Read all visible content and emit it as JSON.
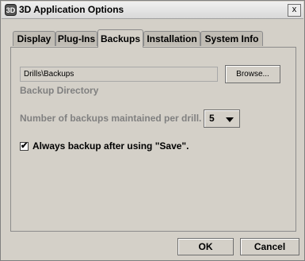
{
  "window": {
    "title": "3D Application Options",
    "close_label": "x"
  },
  "tabs": [
    {
      "label": "Display",
      "active": false
    },
    {
      "label": "Plug-Ins",
      "active": false
    },
    {
      "label": "Backups",
      "active": true
    },
    {
      "label": "Installation",
      "active": false
    },
    {
      "label": "System Info",
      "active": false
    }
  ],
  "backups": {
    "directory_value": "Drills\\Backups",
    "browse_label": "Browse...",
    "directory_label": "Backup Directory",
    "count_label": "Number of backups maintained per drill.",
    "count_value": "5",
    "always_backup_checked": true,
    "always_backup_label": "Always backup after using \"Save\"."
  },
  "footer": {
    "ok_label": "OK",
    "cancel_label": "Cancel"
  }
}
